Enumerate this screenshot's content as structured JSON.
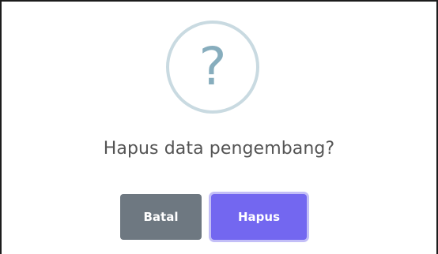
{
  "dialog": {
    "icon": "question-mark-icon",
    "icon_glyph": "?",
    "title": "Hapus data pengembang?",
    "cancel_label": "Batal",
    "confirm_label": "Hapus"
  },
  "colors": {
    "icon_ring": "#c9dae1",
    "icon_glyph": "#87adbd",
    "cancel_button": "#6e7881",
    "confirm_button": "#7367f0",
    "text": "#545454"
  }
}
